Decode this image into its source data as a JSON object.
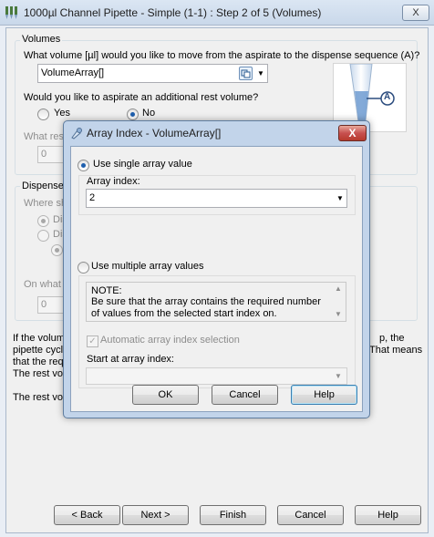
{
  "window": {
    "title": "1000µl Channel Pipette - Simple (1-1) : Step 2 of 5 (Volumes)",
    "close_glyph": "X"
  },
  "volumes": {
    "group_title": "Volumes",
    "question_a": "What volume [µl] would you like to move from the aspirate to the dispense sequence (A)?",
    "value_a": "VolumeArray[]",
    "rest_question": "Would you like to aspirate an additional rest volume?",
    "yes_label": "Yes",
    "no_label": "No",
    "rest_volume_label_partial": "What res",
    "rest_volume_value": "0",
    "tip_label": "A"
  },
  "dispense": {
    "group_title_partial": "Dispense",
    "question_partial": "Where sh",
    "opt1_partial": "Dis",
    "opt2_partial": "Dis",
    "onwhat_partial": "On what",
    "onwhat_value": "0"
  },
  "info": {
    "line1_left": "If the volum",
    "line1_right": "p, the",
    "line2_left": "pipette cycl",
    "line2_right": "That means",
    "line3_left": "that the req",
    "line4_left": "The rest vol",
    "line5_left": "The rest vol"
  },
  "footer": {
    "back": "< Back",
    "next": "Next >",
    "finish": "Finish",
    "cancel": "Cancel",
    "help": "Help"
  },
  "dialog": {
    "title": "Array Index - VolumeArray[]",
    "close_glyph": "X",
    "single_label": "Use single array value",
    "array_index_label": "Array index:",
    "array_index_value": "2",
    "multiple_label": "Use multiple array values",
    "note_title": "NOTE:",
    "note_line1": "Be sure that the array contains the required number",
    "note_line2": "of values from the selected start index on.",
    "auto_label": "Automatic array index selection",
    "start_label": "Start at array index:",
    "start_value": "",
    "ok": "OK",
    "cancel": "Cancel",
    "help": "Help"
  }
}
